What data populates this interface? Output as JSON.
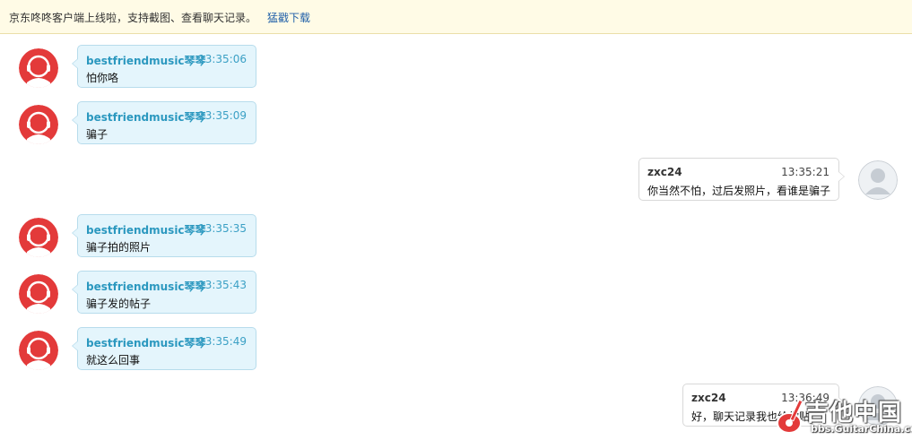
{
  "banner": {
    "text": "京东咚咚客户端上线啦，支持截图、查看聊天记录。",
    "link": "猛戳下载",
    "link_color": "#1f5fa8"
  },
  "colors": {
    "incoming_bubble": "#e4f5fc",
    "incoming_name": "#2b98bf",
    "outgoing_bubble": "#ffffff",
    "support_avatar": "#e33a3a"
  },
  "messages": [
    {
      "sender": "bestfriendmusic琴琴",
      "time": "13:35:06",
      "text": "怕你咯",
      "direction": "incoming",
      "avatar": "support-agent-icon"
    },
    {
      "sender": "bestfriendmusic琴琴",
      "time": "13:35:09",
      "text": "骗子",
      "direction": "incoming",
      "avatar": "support-agent-icon"
    },
    {
      "sender": "zxc24",
      "time": "13:35:21",
      "text": "你当然不怕，过后发照片，看谁是骗子",
      "direction": "outgoing",
      "avatar": "default-user-icon"
    },
    {
      "sender": "bestfriendmusic琴琴",
      "time": "13:35:35",
      "text": "骗子拍的照片",
      "direction": "incoming",
      "avatar": "support-agent-icon"
    },
    {
      "sender": "bestfriendmusic琴琴",
      "time": "13:35:43",
      "text": "骗子发的帖子",
      "direction": "incoming",
      "avatar": "support-agent-icon"
    },
    {
      "sender": "bestfriendmusic琴琴",
      "time": "13:35:49",
      "text": "就这么回事",
      "direction": "incoming",
      "avatar": "support-agent-icon"
    },
    {
      "sender": "zxc24",
      "time": "13:36:49",
      "text": "好，聊天记录我也给你贴",
      "direction": "outgoing",
      "avatar": "default-user-icon"
    }
  ],
  "watermark": {
    "title": "吉他中国",
    "url": "bbs.GuitarChina.com"
  }
}
